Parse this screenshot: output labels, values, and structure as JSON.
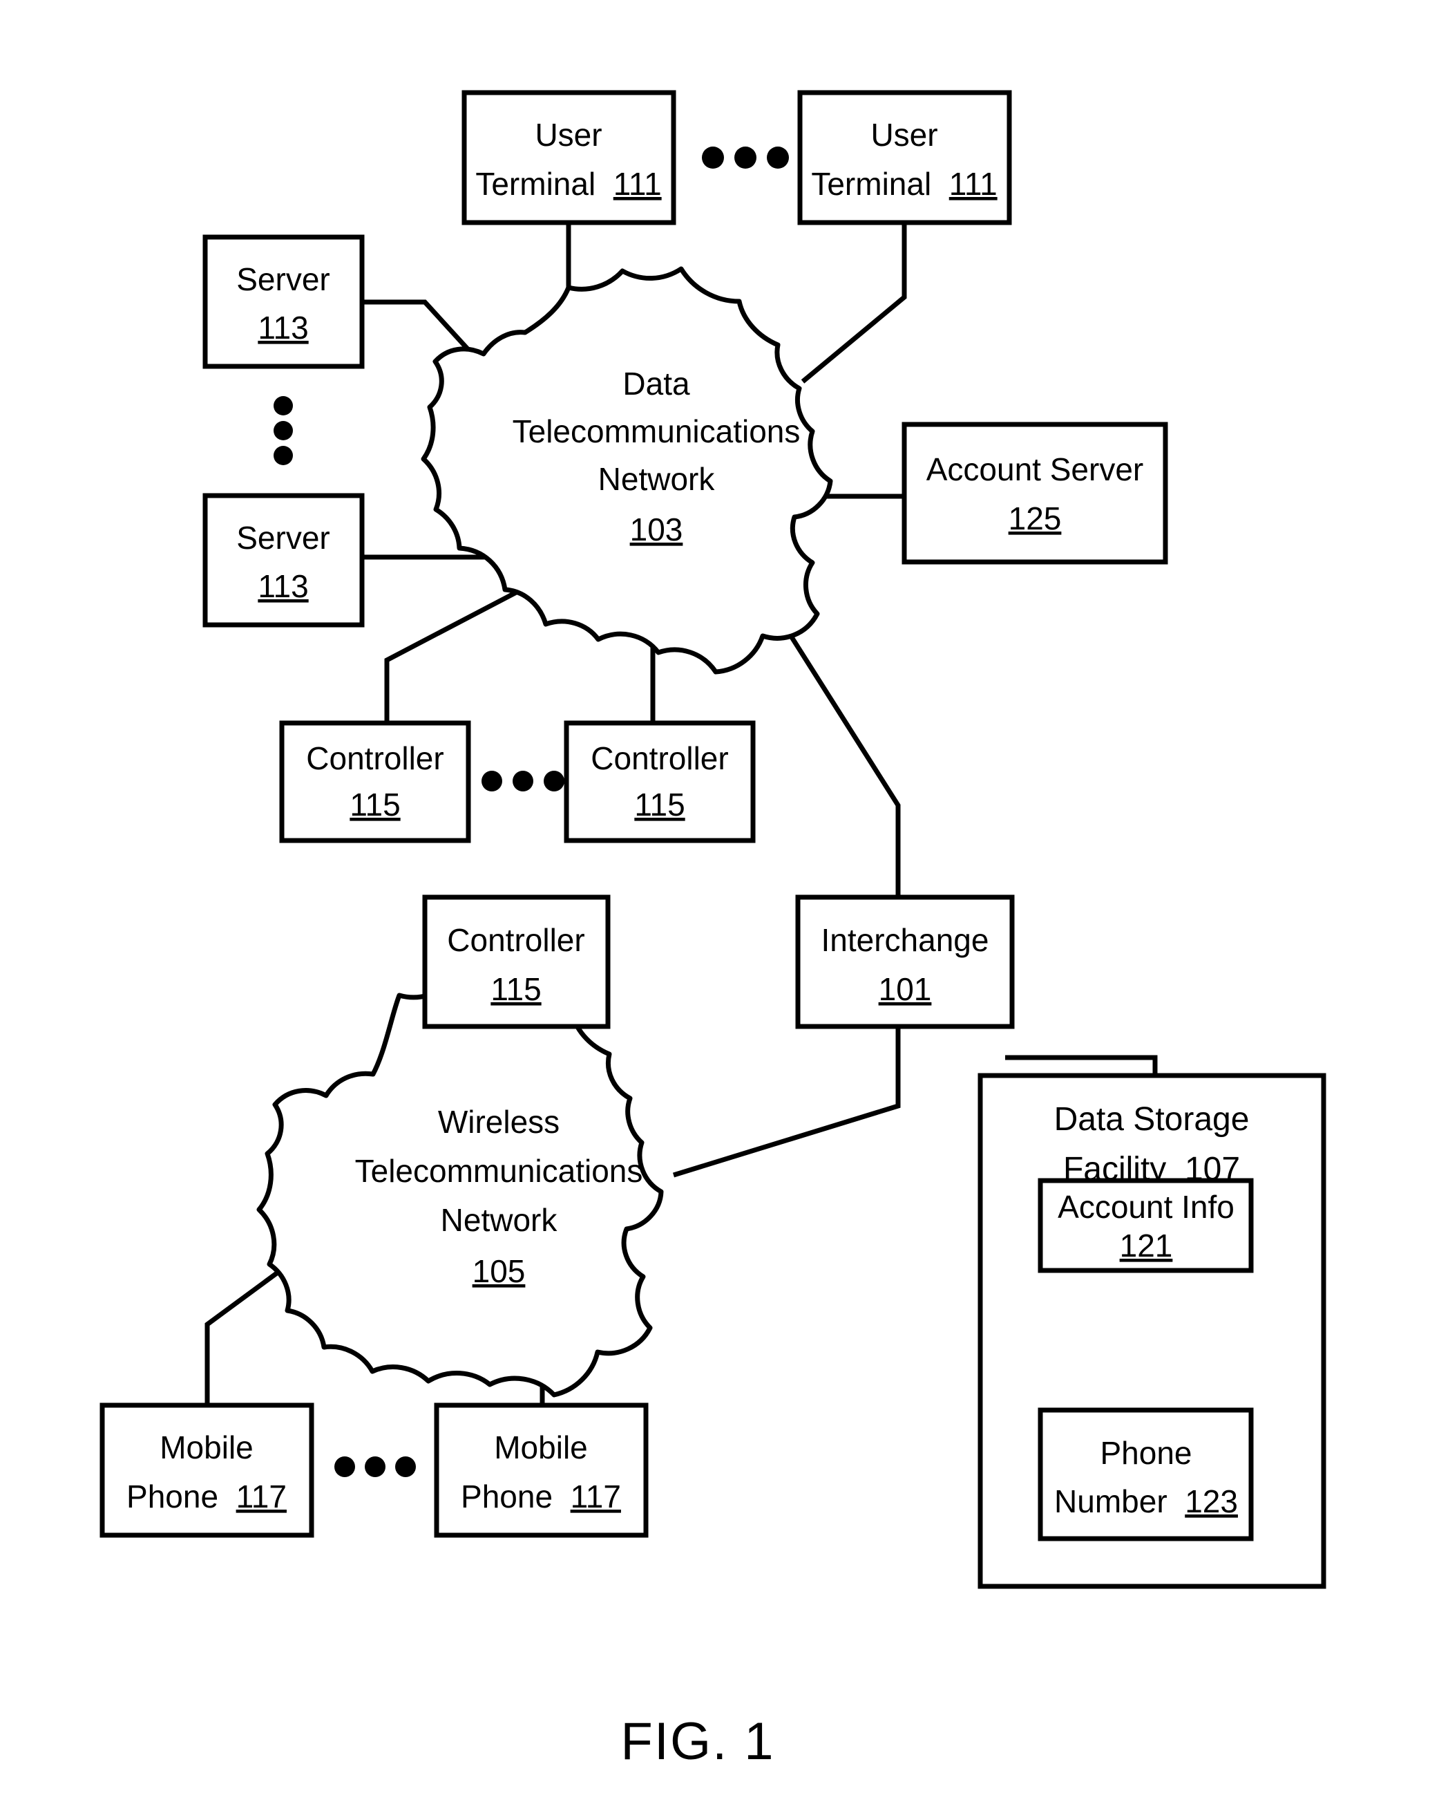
{
  "figure": {
    "caption": "FIG. 1",
    "ink_color": "#000000",
    "background_color": "#ffffff"
  },
  "nodes": {
    "user_terminal_1": {
      "line1": "User",
      "line2": "Terminal",
      "ref": "111"
    },
    "user_terminal_2": {
      "line1": "User",
      "line2": "Terminal",
      "ref": "111"
    },
    "server_top": {
      "line1": "Server",
      "ref": "113"
    },
    "server_bottom": {
      "line1": "Server",
      "ref": "113"
    },
    "data_network": {
      "line1": "Data",
      "line2": "Telecommunications",
      "line3": "Network",
      "ref": "103"
    },
    "account_server": {
      "line1": "Account Server",
      "ref": "125"
    },
    "controller_1": {
      "line1": "Controller",
      "ref": "115"
    },
    "controller_2": {
      "line1": "Controller",
      "ref": "115"
    },
    "controller_3": {
      "line1": "Controller",
      "ref": "115"
    },
    "interchange": {
      "line1": "Interchange",
      "ref": "101"
    },
    "wireless_network": {
      "line1": "Wireless",
      "line2": "Telecommunications",
      "line3": "Network",
      "ref": "105"
    },
    "data_storage_facility": {
      "line1": "Data Storage",
      "line2": "Facility",
      "ref": "107"
    },
    "account_info": {
      "line1": "Account Info",
      "ref": "121"
    },
    "phone_number": {
      "line1": "Phone",
      "line2": "Number",
      "ref": "123"
    },
    "mobile_phone_1": {
      "line1": "Mobile",
      "line2": "Phone",
      "ref": "117"
    },
    "mobile_phone_2": {
      "line1": "Mobile",
      "line2": "Phone",
      "ref": "117"
    }
  },
  "ellipses": {
    "user_terminals": "• • •",
    "servers_vertical": "•",
    "controllers": "• • •",
    "mobile_phones": "• • •"
  }
}
